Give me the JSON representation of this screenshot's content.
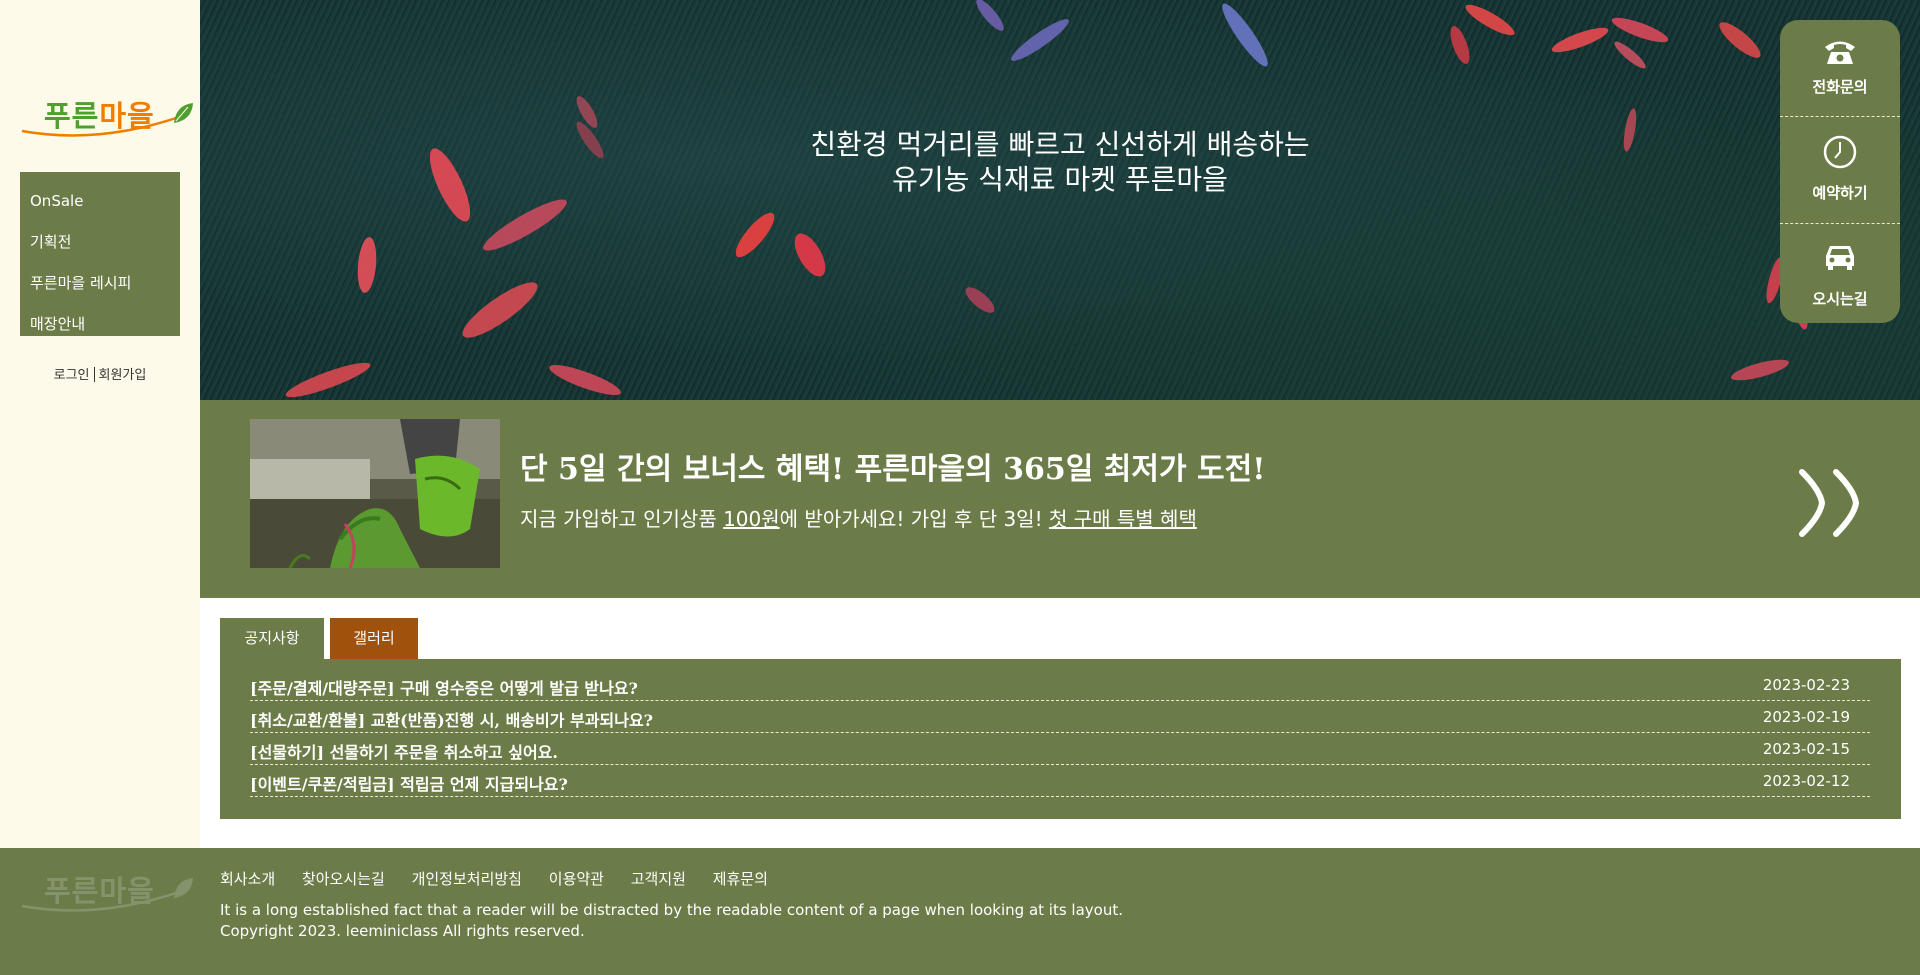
{
  "brand": {
    "logo_part1": "푸른",
    "logo_part2": "마을",
    "green": "#4f9f2e",
    "orange": "#f07d00"
  },
  "sidebar": {
    "menu": [
      {
        "label": "OnSale"
      },
      {
        "label": "기획전"
      },
      {
        "label": "푸른마을 레시피"
      },
      {
        "label": "매장안내"
      }
    ],
    "login_label": "로그인",
    "signup_label": "회원가입"
  },
  "hero": {
    "line1": "친환경 먹거리를 빠르고 신선하게 배송하는",
    "line2": "유기농 식재료 마켓 푸른마을"
  },
  "quick_menu": [
    {
      "label": "전화문의",
      "icon": "phone-icon"
    },
    {
      "label": "예약하기",
      "icon": "clock-icon"
    },
    {
      "label": "오시는길",
      "icon": "car-icon"
    }
  ],
  "promo": {
    "title": "단 5일 간의 보너스 혜택! 푸른마을의 365일 최저가 도전!",
    "sub_part1": "지금 가입하고 인기상품 ",
    "sub_link1": "100원",
    "sub_part2": "에 받아가세요! 가입 후 단 3일! ",
    "sub_link2": "첫 구매 특별 혜택",
    "next_icon": "double-chevron-right-icon"
  },
  "tabs": {
    "notice": "공지사항",
    "gallery": "갤러리"
  },
  "notices": [
    {
      "title": "[주문/결제/대량주문] 구매 영수증은 어떻게 발급 받나요?",
      "date": "2023-02-23"
    },
    {
      "title": "[취소/교환/환불] 교환(반품)진행 시, 배송비가 부과되나요?",
      "date": "2023-02-19"
    },
    {
      "title": "[선물하기] 선물하기 주문을 취소하고 싶어요.",
      "date": "2023-02-15"
    },
    {
      "title": "[이벤트/쿠폰/적립금] 적립금 언제 지급되나요?",
      "date": "2023-02-12"
    }
  ],
  "footer": {
    "links": [
      "회사소개",
      "찾아오시는길",
      "개인정보처리방침",
      "이용약관",
      "고객지원",
      "제휴문의"
    ],
    "desc": "It is a long established fact that a reader will be distracted by the readable content of a page when looking at its layout.",
    "copyright": "Copyright 2023. leeminiclass All rights reserved."
  },
  "colors": {
    "primary": "#6c7c48",
    "sidebar_bg": "#fdfae9",
    "gallery_tab": "#a0520d"
  }
}
